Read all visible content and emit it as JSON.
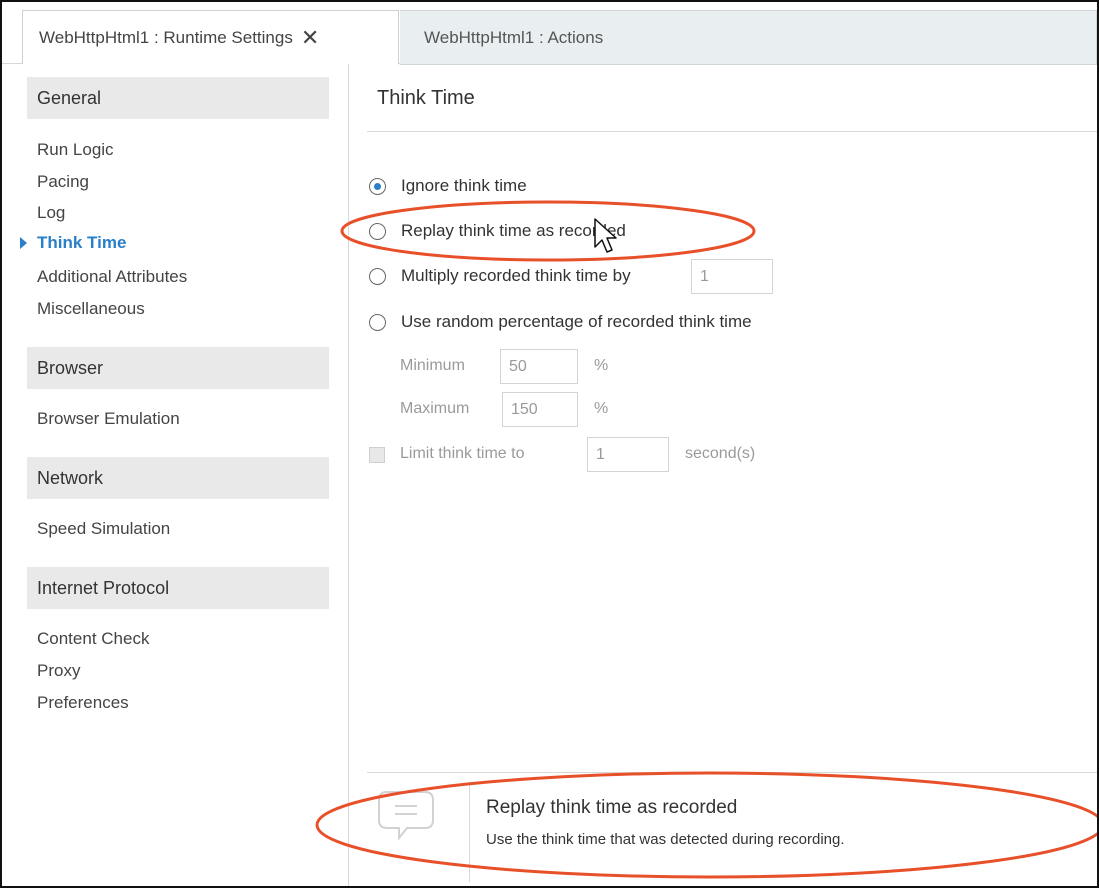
{
  "tabs": [
    {
      "label": "WebHttpHtml1 : Runtime Settings",
      "close_glyph": "✕",
      "active": true
    },
    {
      "label": "WebHttpHtml1 : Actions",
      "active": false
    }
  ],
  "sidebar": {
    "groups": [
      {
        "header": "General",
        "items": [
          "Run Logic",
          "Pacing",
          "Log",
          "Think Time",
          "Additional Attributes",
          "Miscellaneous"
        ]
      },
      {
        "header": "Browser",
        "items": [
          "Browser Emulation"
        ]
      },
      {
        "header": "Network",
        "items": [
          "Speed Simulation"
        ]
      },
      {
        "header": "Internet Protocol",
        "items": [
          "Content Check",
          "Proxy",
          "Preferences"
        ]
      }
    ],
    "active_item": "Think Time"
  },
  "panel": {
    "title": "Think Time",
    "options": [
      {
        "label": "Ignore think time",
        "selected": true
      },
      {
        "label": "Replay think time as recorded",
        "selected": false
      },
      {
        "label": "Multiply recorded think time by",
        "selected": false,
        "value": "1"
      },
      {
        "label": "Use random percentage of recorded think time",
        "selected": false
      }
    ],
    "minimum": {
      "label": "Minimum",
      "value": "50",
      "unit": "%"
    },
    "maximum": {
      "label": "Maximum",
      "value": "150",
      "unit": "%"
    },
    "limit": {
      "label": "Limit think time to",
      "value": "1",
      "unit": "second(s)",
      "checked": false
    }
  },
  "help": {
    "icon": "comment-icon",
    "title": "Replay think time as recorded",
    "description": "Use the think time that was detected during recording."
  },
  "colors": {
    "accent": "#2a7fc9",
    "annotation": "#e8502a"
  }
}
